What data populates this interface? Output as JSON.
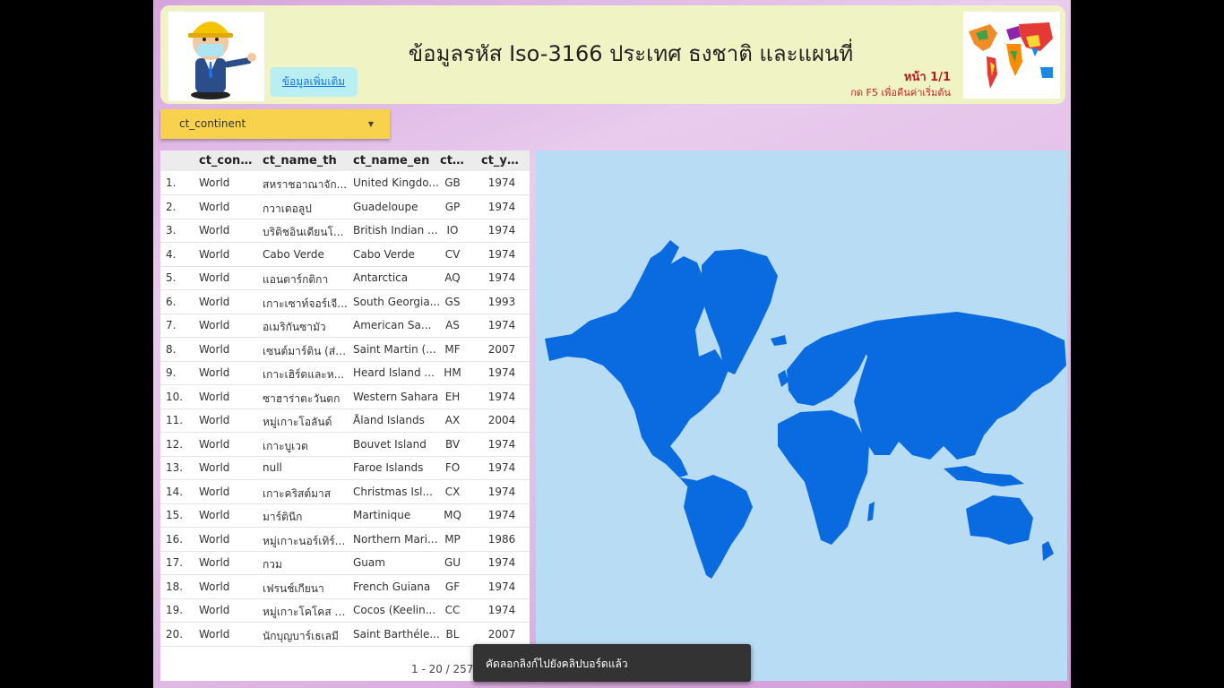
{
  "header": {
    "title": "ข้อมูลรหัส Iso-3166 ประเทศ ธงชาติ และแผนที่",
    "more_link": "ข้อมูลเพิ่มเติม",
    "page": "หน้า 1/1",
    "hint": "กด F5 เพื่อคืนค่าเริ่มต้น"
  },
  "filter": {
    "label": "ct_continent"
  },
  "table": {
    "columns": [
      "ct_cont...",
      "ct_name_th",
      "ct_name_en",
      "ct...",
      "ct_year"
    ],
    "rows": [
      [
        "1.",
        "World",
        "สหราชอาณาจัก...",
        "United Kingdo...",
        "GB",
        "1974"
      ],
      [
        "2.",
        "World",
        "กวาเดอลูป",
        "Guadeloupe",
        "GP",
        "1974"
      ],
      [
        "3.",
        "World",
        "บริติชอินเดียนโ...",
        "British Indian ...",
        "IO",
        "1974"
      ],
      [
        "4.",
        "World",
        "Cabo Verde",
        "Cabo Verde",
        "CV",
        "1974"
      ],
      [
        "5.",
        "World",
        "แอนตาร์กติกา",
        "Antarctica",
        "AQ",
        "1974"
      ],
      [
        "6.",
        "World",
        "เกาะเซาท์จอร์เจี...",
        "South Georgia...",
        "GS",
        "1993"
      ],
      [
        "7.",
        "World",
        "อเมริกันซามัว",
        "American Sa...",
        "AS",
        "1974"
      ],
      [
        "8.",
        "World",
        "เซนต์มาร์ติน (ส่ว...",
        "Saint Martin (...",
        "MF",
        "2007"
      ],
      [
        "9.",
        "World",
        "เกาะเฮิร์ดและห...",
        "Heard Island ...",
        "HM",
        "1974"
      ],
      [
        "10.",
        "World",
        "ซาฮาร่าตะวันตก",
        "Western Sahara",
        "EH",
        "1974"
      ],
      [
        "11.",
        "World",
        "หมู่เกาะโอลันด์",
        "Åland Islands",
        "AX",
        "2004"
      ],
      [
        "12.",
        "World",
        "เกาะบูเวต",
        "Bouvet Island",
        "BV",
        "1974"
      ],
      [
        "13.",
        "World",
        "null",
        "Faroe Islands",
        "FO",
        "1974"
      ],
      [
        "14.",
        "World",
        "เกาะคริสต์มาส",
        "Christmas Isl...",
        "CX",
        "1974"
      ],
      [
        "15.",
        "World",
        "มาร์ตินีก",
        "Martinique",
        "MQ",
        "1974"
      ],
      [
        "16.",
        "World",
        "หมู่เกาะนอร์เทิร์...",
        "Northern Mari...",
        "MP",
        "1986"
      ],
      [
        "17.",
        "World",
        "กวม",
        "Guam",
        "GU",
        "1974"
      ],
      [
        "18.",
        "World",
        "เฟรนช์เกียนา",
        "French Guiana",
        "GF",
        "1974"
      ],
      [
        "19.",
        "World",
        "หมู่เกาะโคโคส (...",
        "Cocos (Keelin...",
        "CC",
        "1974"
      ],
      [
        "20.",
        "World",
        "นักบุญบาร์เธเลมี",
        "Saint Barthéle...",
        "BL",
        "2007"
      ]
    ],
    "pagination": "1 - 20 / 257"
  },
  "snackbar": {
    "text": "คัดลอกลิงก์ไปยังคลิปบอร์ดแล้ว"
  },
  "colors": {
    "map_land": "#0a6be0",
    "map_water": "#b9dcf5",
    "header_bg": "#f0f3c4",
    "filter_bg": "#f8d24c"
  }
}
